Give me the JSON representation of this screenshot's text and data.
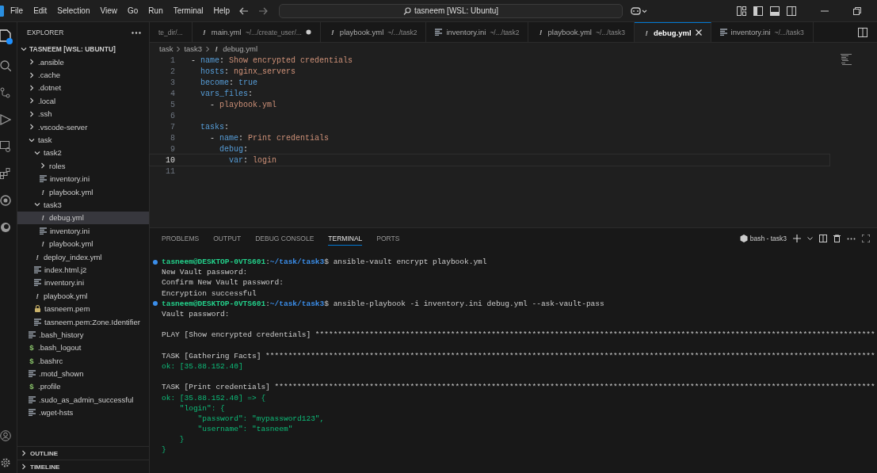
{
  "menu": {
    "items": [
      "File",
      "Edit",
      "Selection",
      "View",
      "Go",
      "Run",
      "Terminal",
      "Help"
    ],
    "search": {
      "value": "tasneem [WSL: Ubuntu]"
    }
  },
  "explorer": {
    "title": "EXPLORER",
    "root": {
      "label": "TASNEEM [WSL: UBUNTU]",
      "expanded": true,
      "children": [
        {
          "label": ".ansible",
          "kind": "folder",
          "expanded": false,
          "selected": false
        },
        {
          "label": ".cache",
          "kind": "folder",
          "expanded": false,
          "selected": false
        },
        {
          "label": ".dotnet",
          "kind": "folder",
          "expanded": false,
          "selected": false
        },
        {
          "label": ".local",
          "kind": "folder",
          "expanded": false,
          "selected": false
        },
        {
          "label": ".ssh",
          "kind": "folder",
          "expanded": false,
          "selected": false
        },
        {
          "label": ".vscode-server",
          "kind": "folder",
          "expanded": false,
          "selected": false
        },
        {
          "label": "task",
          "kind": "folder",
          "expanded": true,
          "selected": false,
          "children": [
            {
              "label": "task2",
              "kind": "folder",
              "expanded": true,
              "selected": false,
              "children": [
                {
                  "label": "roles",
                  "kind": "folder",
                  "expanded": false,
                  "selected": false
                },
                {
                  "label": "inventory.ini",
                  "kind": "text",
                  "selected": false
                },
                {
                  "label": "playbook.yml",
                  "kind": "glyph",
                  "icon": "!",
                  "selected": false
                }
              ]
            },
            {
              "label": "task3",
              "kind": "folder",
              "expanded": true,
              "selected": false,
              "children": [
                {
                  "label": "debug.yml",
                  "kind": "glyph",
                  "icon": "!",
                  "selected": true
                },
                {
                  "label": "inventory.ini",
                  "kind": "text",
                  "selected": false
                },
                {
                  "label": "playbook.yml",
                  "kind": "glyph",
                  "icon": "!",
                  "selected": false
                }
              ]
            },
            {
              "label": "deploy_index.yml",
              "kind": "glyph",
              "icon": "!",
              "selected": false
            },
            {
              "label": "index.html.j2",
              "kind": "text",
              "selected": false
            },
            {
              "label": "inventory.ini",
              "kind": "text",
              "selected": false
            },
            {
              "label": "playbook.yml",
              "kind": "glyph",
              "icon": "!",
              "selected": false
            },
            {
              "label": "tasneem.pem",
              "kind": "key",
              "selected": false
            },
            {
              "label": "tasneem.pem:Zone.Identifier",
              "kind": "text",
              "selected": false
            }
          ]
        },
        {
          "label": ".bash_history",
          "kind": "text",
          "selected": false
        },
        {
          "label": ".bash_logout",
          "kind": "shell",
          "icon": "$",
          "selected": false
        },
        {
          "label": ".bashrc",
          "kind": "shell",
          "icon": "$",
          "selected": false
        },
        {
          "label": ".motd_shown",
          "kind": "text",
          "selected": false
        },
        {
          "label": ".profile",
          "kind": "shell",
          "icon": "$",
          "selected": false
        },
        {
          "label": ".sudo_as_admin_successful",
          "kind": "text",
          "selected": false
        },
        {
          "label": ".wget-hsts",
          "kind": "text",
          "selected": false
        }
      ]
    },
    "sections": [
      {
        "label": "OUTLINE",
        "expanded": false
      },
      {
        "label": "TIMELINE",
        "expanded": false
      }
    ]
  },
  "tabs": [
    {
      "path": "te_dir/...",
      "selected": false,
      "modified": false
    },
    {
      "name": "main.yml",
      "kind": "glyph",
      "icon": "!",
      "path": "~/.../create_user/...",
      "selected": false,
      "modified": true
    },
    {
      "name": "playbook.yml",
      "kind": "glyph",
      "icon": "!",
      "path": "~/.../task2",
      "selected": false,
      "modified": false
    },
    {
      "name": "inventory.ini",
      "kind": "text",
      "path": "~/.../task2",
      "selected": false,
      "modified": false
    },
    {
      "name": "playbook.yml",
      "kind": "glyph",
      "icon": "!",
      "path": "~/.../task3",
      "selected": false,
      "modified": false
    },
    {
      "name": "debug.yml",
      "kind": "glyph",
      "icon": "!",
      "selected": true,
      "modified": false
    },
    {
      "name": "inventory.ini",
      "kind": "text",
      "path": "~/.../task3",
      "selected": false,
      "modified": false
    }
  ],
  "breadcrumb": [
    {
      "label": "task"
    },
    {
      "label": "task3"
    },
    {
      "label": "debug.yml",
      "icon": "!"
    }
  ],
  "editor": {
    "lines": [
      {
        "number": "1",
        "active": false,
        "tokens": [
          {
            "kind": "punct",
            "text": "- "
          },
          {
            "kind": "key",
            "text": "name"
          },
          {
            "kind": "punct",
            "text": ": "
          },
          {
            "kind": "string",
            "text": "Show encrypted credentials"
          }
        ]
      },
      {
        "number": "2",
        "active": false,
        "tokens": [
          {
            "kind": "key",
            "text": "  hosts"
          },
          {
            "kind": "punct",
            "text": ": "
          },
          {
            "kind": "string",
            "text": "nginx_servers"
          }
        ]
      },
      {
        "number": "3",
        "active": false,
        "tokens": [
          {
            "kind": "key",
            "text": "  become"
          },
          {
            "kind": "punct",
            "text": ": "
          },
          {
            "kind": "keyword",
            "text": "true"
          }
        ]
      },
      {
        "number": "4",
        "active": false,
        "tokens": [
          {
            "kind": "key",
            "text": "  vars_files"
          },
          {
            "kind": "punct",
            "text": ":"
          }
        ]
      },
      {
        "number": "5",
        "active": false,
        "tokens": [
          {
            "kind": "punct",
            "text": "    - "
          },
          {
            "kind": "string",
            "text": "playbook.yml"
          }
        ]
      },
      {
        "number": "6",
        "active": false
      },
      {
        "number": "7",
        "active": false,
        "tokens": [
          {
            "kind": "key",
            "text": "  tasks"
          },
          {
            "kind": "punct",
            "text": ":"
          }
        ]
      },
      {
        "number": "8",
        "active": false,
        "tokens": [
          {
            "kind": "punct",
            "text": "    - "
          },
          {
            "kind": "key",
            "text": "name"
          },
          {
            "kind": "punct",
            "text": ": "
          },
          {
            "kind": "string",
            "text": "Print credentials"
          }
        ]
      },
      {
        "number": "9",
        "active": false,
        "tokens": [
          {
            "kind": "key",
            "text": "      debug"
          },
          {
            "kind": "punct",
            "text": ":"
          }
        ]
      },
      {
        "number": "10",
        "active": true,
        "tokens": [
          {
            "kind": "key",
            "text": "        var"
          },
          {
            "kind": "punct",
            "text": ": "
          },
          {
            "kind": "string",
            "text": "login"
          }
        ]
      },
      {
        "number": "11",
        "active": false
      }
    ]
  },
  "panel": {
    "tabs": [
      {
        "label": "PROBLEMS",
        "selected": false
      },
      {
        "label": "OUTPUT",
        "selected": false
      },
      {
        "label": "DEBUG CONSOLE",
        "selected": false
      },
      {
        "label": "TERMINAL",
        "selected": true
      },
      {
        "label": "PORTS",
        "selected": false
      }
    ],
    "terminal_name": "bash - task3",
    "lines": [
      {
        "prompt": true,
        "segments": [
          {
            "kind": "user",
            "text": "tasneem@DESKTOP-0VTS601"
          },
          {
            "kind": "plain",
            "text": ":"
          },
          {
            "kind": "path",
            "text": "~/task/task3"
          },
          {
            "kind": "plain",
            "text": "$ ansible-vault encrypt playbook.yml"
          }
        ]
      },
      {
        "segments": [
          {
            "kind": "plain",
            "text": "New Vault password:"
          }
        ]
      },
      {
        "segments": [
          {
            "kind": "plain",
            "text": "Confirm New Vault password:"
          }
        ]
      },
      {
        "segments": [
          {
            "kind": "plain",
            "text": "Encryption successful"
          }
        ]
      },
      {
        "prompt": true,
        "segments": [
          {
            "kind": "user",
            "text": "tasneem@DESKTOP-0VTS601"
          },
          {
            "kind": "plain",
            "text": ":"
          },
          {
            "kind": "path",
            "text": "~/task/task3"
          },
          {
            "kind": "plain",
            "text": "$ ansible-playbook -i inventory.ini debug.yml --ask-vault-pass"
          }
        ]
      },
      {
        "segments": [
          {
            "kind": "plain",
            "text": "Vault password:"
          }
        ]
      },
      {
        "gap_before": true,
        "segments": [
          {
            "kind": "plain",
            "text": "PLAY [Show encrypted credentials] ****************************************************************************************************************************"
          }
        ]
      },
      {
        "gap_before": true,
        "segments": [
          {
            "kind": "plain",
            "text": "TASK [Gathering Facts] ***************************************************************************************************************************************"
          }
        ]
      },
      {
        "segments": [
          {
            "kind": "ok",
            "text": "ok: [35.88.152.40]"
          }
        ]
      },
      {
        "gap_before": true,
        "segments": [
          {
            "kind": "plain",
            "text": "TASK [Print credentials] *************************************************************************************************************************************"
          }
        ]
      },
      {
        "segments": [
          {
            "kind": "ok",
            "text": "ok: [35.88.152.40] => {"
          }
        ]
      },
      {
        "segments": [
          {
            "kind": "ok",
            "text": "    \"login\": {"
          }
        ]
      },
      {
        "segments": [
          {
            "kind": "ok",
            "text": "        \"password\": \"mypassword123\","
          }
        ]
      },
      {
        "segments": [
          {
            "kind": "ok",
            "text": "        \"username\": \"tasneem\""
          }
        ]
      },
      {
        "segments": [
          {
            "kind": "ok",
            "text": "    }"
          }
        ]
      },
      {
        "segments": [
          {
            "kind": "ok",
            "text": "}"
          }
        ]
      }
    ]
  }
}
